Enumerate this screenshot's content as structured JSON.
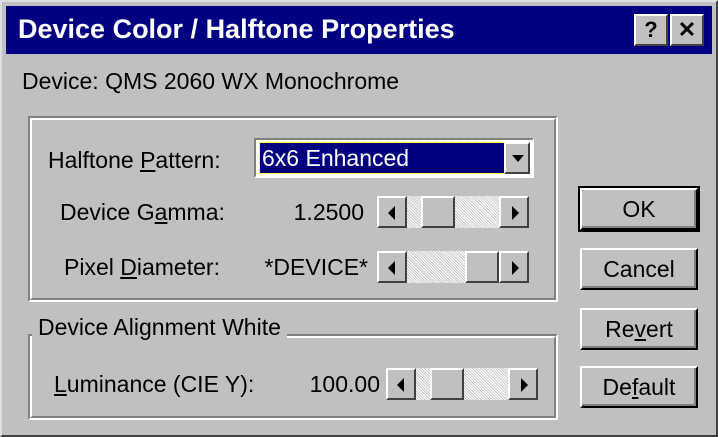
{
  "window": {
    "title": "Device Color / Halftone Properties",
    "help_label": "?",
    "close_label": "✕"
  },
  "device": {
    "label": "Device: QMS 2060 WX Monochrome"
  },
  "halftone": {
    "label_pre": "Halftone ",
    "label_accel": "P",
    "label_post": "attern:",
    "selected": "6x6 Enhanced"
  },
  "gamma": {
    "label_pre": "Device G",
    "label_accel": "a",
    "label_post": "mma:",
    "value": "1.2500"
  },
  "pixel": {
    "label_pre": "Pixel ",
    "label_accel": "D",
    "label_post": "iameter:",
    "value": "*DEVICE*"
  },
  "alignment": {
    "group_title": "Device Alignment White",
    "label_accel": "L",
    "label_post": "uminance (CIE Y):",
    "value": "100.00"
  },
  "buttons": {
    "ok_label": "OK",
    "cancel_label": "Cancel",
    "revert_pre": "Re",
    "revert_accel": "v",
    "revert_post": "ert",
    "default_pre": "De",
    "default_accel": "f",
    "default_post": "ault"
  },
  "colors": {
    "titlebar": "#000080",
    "face": "#c0c0c0",
    "selection": "#000080"
  }
}
